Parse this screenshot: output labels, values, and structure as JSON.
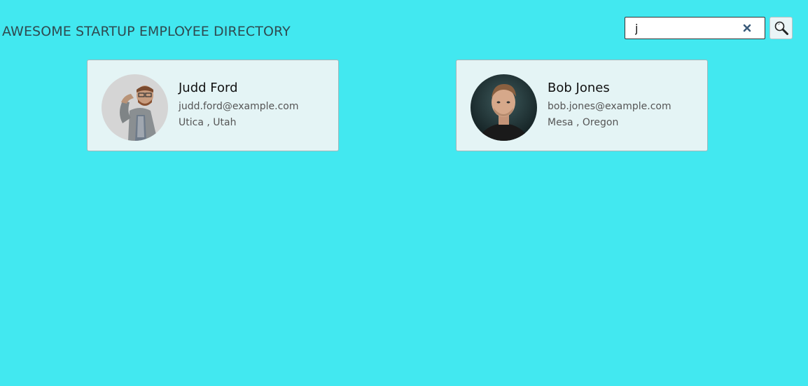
{
  "header": {
    "title": "AWESOME STARTUP EMPLOYEE DIRECTORY"
  },
  "search": {
    "value": "j",
    "clear_icon": "close-icon",
    "search_icon": "magnifier-icon"
  },
  "employees": [
    {
      "name": "Judd Ford",
      "email": "judd.ford@example.com",
      "location": "Utica , Utah",
      "avatar": "person-photo"
    },
    {
      "name": "Bob Jones",
      "email": "bob.jones@example.com",
      "location": "Mesa , Oregon",
      "avatar": "person-photo"
    }
  ],
  "colors": {
    "background": "#42e8f0",
    "card": "#e4f4f5",
    "clear_icon": "#3b5b7a"
  }
}
